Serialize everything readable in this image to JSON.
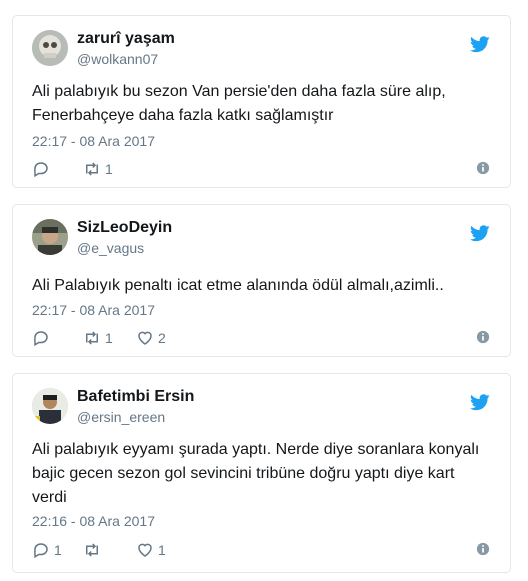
{
  "colors": {
    "twitter_blue": "#1da1f2",
    "muted": "#657786",
    "border": "#e1e8ed"
  },
  "tweets": [
    {
      "display_name": "zarurî yaşam",
      "handle": "@wolkann07",
      "text_lines": [
        "Ali palabıyık bu sezon Van persie'den daha fazla süre alıp,",
        "Fenerbahçeye daha fazla katkı sağlamıştır"
      ],
      "timestamp": "22:17 - 08 Ara 2017",
      "retweets": "1",
      "likes": ""
    },
    {
      "display_name": "SizLeoDeyin",
      "handle": "@e_vagus",
      "text_lines": [
        "Ali Palabıyık penaltı icat etme alanında ödül almalı,azimli.."
      ],
      "timestamp": "22:17 - 08 Ara 2017",
      "retweets": "1",
      "likes": "2"
    },
    {
      "display_name": "Bafetimbi Ersin",
      "handle": "@ersin_ereen",
      "text_lines": [
        "Ali palabıyık eyyamı şurada yaptı. Nerde diye soranlara konyalı",
        "bajic gecen sezon gol sevincini tribüne doğru yaptı diye kart",
        "verdi"
      ],
      "timestamp": "22:16 - 08 Ara 2017",
      "replies": "1",
      "likes": "1"
    }
  ]
}
